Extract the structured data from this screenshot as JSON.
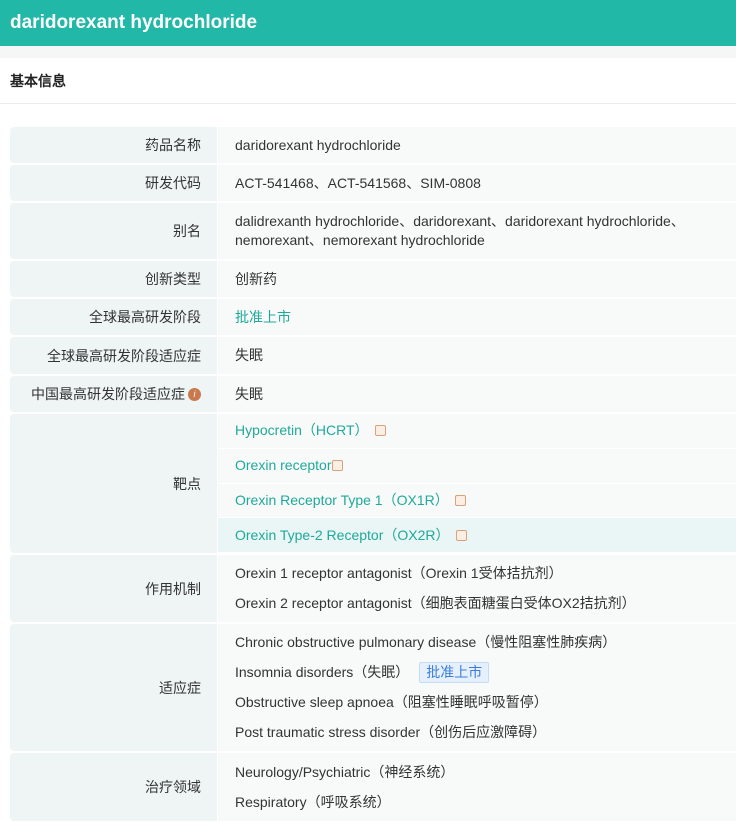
{
  "header": {
    "title": "daridorexant hydrochloride"
  },
  "section": {
    "title": "基本信息"
  },
  "rows": {
    "name": {
      "label": "药品名称",
      "value": "daridorexant hydrochloride"
    },
    "code": {
      "label": "研发代码",
      "value": "ACT-541468、ACT-541568、SIM-0808"
    },
    "alias": {
      "label": "别名",
      "value": "dalidrexanth hydrochloride、daridorexant、daridorexant hydrochloride、nemorexant、nemorexant hydrochloride"
    },
    "type": {
      "label": "创新类型",
      "value": "创新药"
    },
    "stage": {
      "label": "全球最高研发阶段",
      "value": "批准上市"
    },
    "stage_ind": {
      "label": "全球最高研发阶段适应症",
      "value": "失眠"
    },
    "cn_ind": {
      "label": "中国最高研发阶段适应症",
      "value": "失眠",
      "info_icon": "i"
    },
    "targets": {
      "label": "靶点",
      "items": [
        "Hypocretin（HCRT）",
        "Orexin receptor",
        "Orexin Receptor Type 1（OX1R）",
        "Orexin Type-2 Receptor（OX2R）"
      ]
    },
    "mechanism": {
      "label": "作用机制",
      "items": [
        "Orexin 1 receptor antagonist（Orexin 1受体拮抗剂）",
        "Orexin 2 receptor antagonist（细胞表面糖蛋白受体OX2拮抗剂）"
      ]
    },
    "indications": {
      "label": "适应症",
      "items": [
        "Chronic obstructive pulmonary disease（慢性阻塞性肺疾病）",
        "Insomnia disorders（失眠）",
        "Obstructive sleep apnoea（阻塞性睡眠呼吸暂停）",
        "Post traumatic stress disorder（创伤后应激障碍）"
      ],
      "badge": "批准上市"
    },
    "areas": {
      "label": "治疗领域",
      "items": [
        "Neurology/Psychiatric（神经系统）",
        "Respiratory（呼吸系统）"
      ]
    }
  }
}
